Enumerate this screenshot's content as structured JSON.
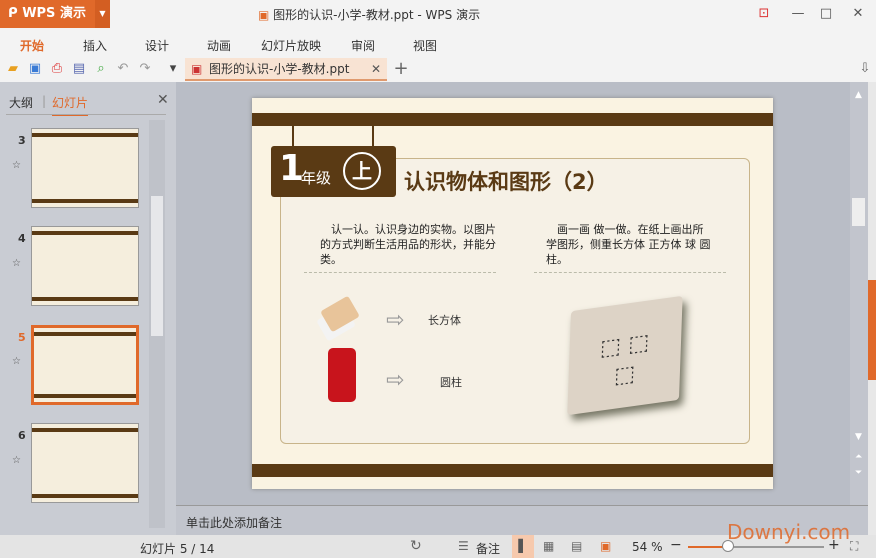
{
  "app": {
    "name": "WPS 演示",
    "window_title": "图形的认识-小学-教材.ppt - WPS 演示"
  },
  "menu": [
    "开始",
    "插入",
    "设计",
    "动画",
    "幻灯片放映",
    "审阅",
    "视图"
  ],
  "doc_tab": "图形的认识-小学-教材.ppt",
  "panel": {
    "tabs": [
      "大纲",
      "幻灯片"
    ],
    "separator": "|",
    "thumbs": [
      {
        "num": "3"
      },
      {
        "num": "4"
      },
      {
        "num": "5",
        "selected": true
      },
      {
        "num": "6"
      }
    ]
  },
  "slide": {
    "grade_num": "1",
    "grade": "年级",
    "term": "上",
    "title": "认识物体和图形（2）",
    "left_text": "　认一认。认识身边的实物。以图片的方式判断生活用品的形状，并能分类。",
    "right_text": "　画一画 做一做。在纸上画出所学图形，侧重长方体 正方体 球 圆柱。",
    "label1": "长方体",
    "label2": "圆柱"
  },
  "notes_placeholder": "单击此处添加备注",
  "status": {
    "slide_counter": "幻灯片 5 / 14",
    "notes_label": "备注",
    "zoom": "54 %",
    "zoom_fraction": 0.3
  },
  "watermark": "Downyi.com",
  "colors": {
    "accent": "#e0692a",
    "brown": "#5a3a14"
  }
}
